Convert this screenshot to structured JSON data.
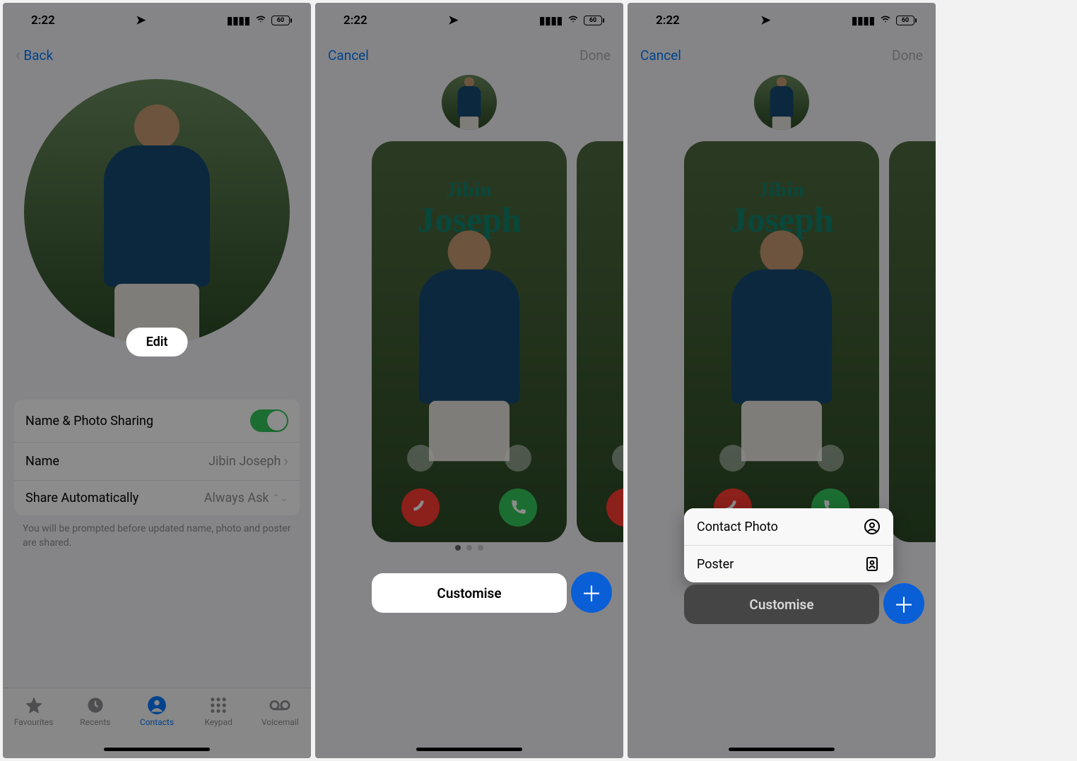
{
  "status": {
    "time": "2:22",
    "battery": "60"
  },
  "screen1": {
    "nav": {
      "back": "Back"
    },
    "edit_button": "Edit",
    "rows": {
      "sharing_label": "Name & Photo Sharing",
      "name_label": "Name",
      "name_value": "Jibin Joseph",
      "share_auto_label": "Share Automatically",
      "share_auto_value": "Always Ask"
    },
    "footnote": "You will be prompted before updated name, photo and poster are shared.",
    "tabs": {
      "favourites": "Favourites",
      "recents": "Recents",
      "contacts": "Contacts",
      "keypad": "Keypad",
      "voicemail": "Voicemail"
    }
  },
  "screen2": {
    "nav": {
      "cancel": "Cancel",
      "done": "Done"
    },
    "poster_name_first": "Jibin",
    "poster_name_last": "Joseph",
    "customise": "Customise"
  },
  "screen3": {
    "nav": {
      "cancel": "Cancel",
      "done": "Done"
    },
    "poster_name_first": "Jibin",
    "poster_name_last": "Joseph",
    "customise": "Customise",
    "menu": {
      "contact_photo": "Contact Photo",
      "poster": "Poster"
    }
  }
}
